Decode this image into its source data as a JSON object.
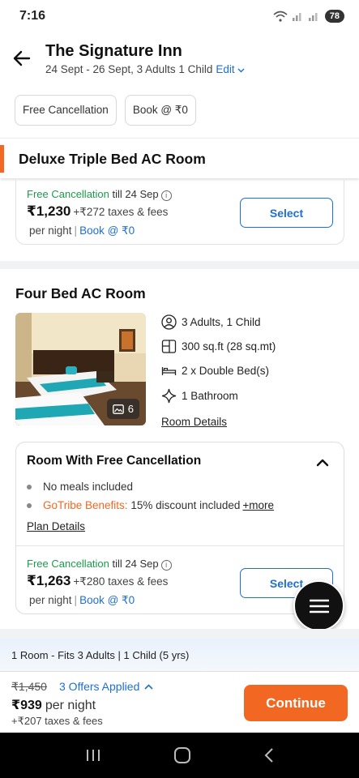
{
  "status_bar": {
    "time": "7:16",
    "battery": "78"
  },
  "header": {
    "title": "The Signature Inn",
    "stay_info": "24 Sept - 26 Sept, 3 Adults 1 Child",
    "edit_label": "Edit"
  },
  "filters": [
    "Free Cancellation",
    "Book @ ₹0"
  ],
  "sticky_room": {
    "title": "Deluxe Triple Bed AC Room"
  },
  "room1_plan": {
    "free_cancellation": "Free Cancellation",
    "till": "till 24 Sep",
    "price": "₹1,230",
    "taxes": "+₹272 taxes & fees",
    "per_night": "per night",
    "book_label": "Book @ ₹0",
    "select_label": "Select"
  },
  "room2": {
    "title": "Four Bed AC Room",
    "photo_count": "6",
    "features": [
      "3 Adults, 1 Child",
      "300 sq.ft (28 sq.mt)",
      "2 x Double Bed(s)",
      "1 Bathroom"
    ],
    "room_details_label": "Room Details",
    "plan": {
      "title": "Room With Free Cancellation",
      "meals": "No meals included",
      "gotribe_label": "GoTribe Benefits:",
      "gotribe_text": "15% discount included",
      "more_label": "+more",
      "plan_details_label": "Plan Details",
      "free_cancellation": "Free Cancellation",
      "till": "till 24 Sep",
      "price": "₹1,263",
      "taxes": "+₹280 taxes & fees",
      "per_night": "per night",
      "book_label": "Book @ ₹0",
      "select_label": "Select"
    }
  },
  "fits_bar": "1 Room - Fits 3 Adults | 1 Child (5 yrs)",
  "bottom": {
    "old_price": "₹1,450",
    "offers_label": "3 Offers Applied",
    "final_price": "₹939",
    "per_night": "per night",
    "taxes": "+₹207 taxes & fees",
    "continue_label": "Continue"
  },
  "colors": {
    "accent": "#f26722",
    "link": "#1f6fd1",
    "green": "#1a9b4a"
  }
}
